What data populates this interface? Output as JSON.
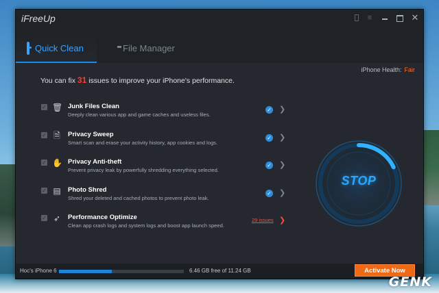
{
  "window": {
    "title": "iFreeUp"
  },
  "tabs": [
    {
      "label": "Quick Clean",
      "active": true,
      "icon": "phone-icon"
    },
    {
      "label": "File Manager",
      "active": false,
      "icon": "folder-icon"
    }
  ],
  "health": {
    "label": "iPhone Health:",
    "value": "Fair",
    "color": "#ff6a2e"
  },
  "headline": {
    "prefix": "You can fix",
    "count": "31",
    "suffix": "issues to improve your iPhone's performance."
  },
  "items": [
    {
      "title": "Junk Files Clean",
      "desc": "Deeply clean various app and game caches and useless files.",
      "icon": "trash-icon",
      "checked": true,
      "status": "ok"
    },
    {
      "title": "Privacy Sweep",
      "desc": "Smart scan and erase your activity history, app cookies and logs.",
      "icon": "document-icon",
      "checked": true,
      "status": "ok"
    },
    {
      "title": "Privacy Anti-theft",
      "desc": "Prevent privacy leak by powerfully shredding everything selected.",
      "icon": "hand-icon",
      "checked": true,
      "status": "ok"
    },
    {
      "title": "Photo Shred",
      "desc": "Shred your deleted and cached photos to prevent photo leak.",
      "icon": "shredder-icon",
      "checked": true,
      "status": "ok"
    },
    {
      "title": "Performance Optimize",
      "desc": "Clean app crash logs and system logs and boost app launch speed.",
      "icon": "rocket-icon",
      "checked": true,
      "status": "issues",
      "issues_label": "29 issues"
    }
  ],
  "scan_button": {
    "label": "STOP",
    "progress": 0.18,
    "color": "#29a8ff"
  },
  "status": {
    "device": "Hoc's iPhone 6",
    "storage_text": "6.46 GB free of 11.24 GB",
    "storage_used_fraction": 0.425,
    "activate_label": "Activate Now"
  },
  "watermark": "GENK"
}
